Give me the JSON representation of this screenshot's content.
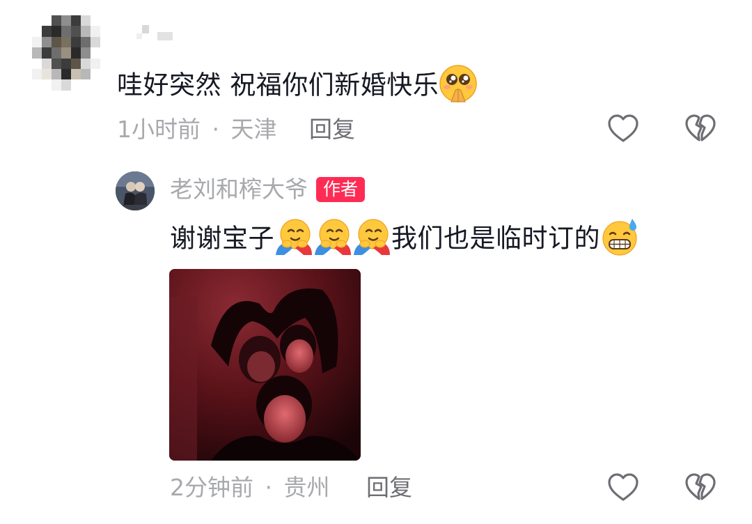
{
  "comment": {
    "text": "哇好突然 祝福你们新婚快乐",
    "emoji": "pleading-face-with-hands",
    "time": "1小时前",
    "separator": "·",
    "location": "天津",
    "reply_label": "回复"
  },
  "reply": {
    "username": "老刘和榨大爷",
    "badge": "作者",
    "text_part1": "谢谢宝子",
    "hug_emoji_count": 3,
    "text_part2": "我们也是临时订的",
    "emoji_end": "grinning-sweat-face",
    "time": "2分钟前",
    "separator": "·",
    "location": "贵州",
    "reply_label": "回复"
  },
  "colors": {
    "badge_bg": "#fe2c55",
    "meta_text": "#a8a9ad",
    "reply_text": "#6d6e73",
    "icon_stroke": "#6d6e73"
  },
  "icons": {
    "like": "heart-outline-icon",
    "dislike": "broken-heart-icon"
  }
}
